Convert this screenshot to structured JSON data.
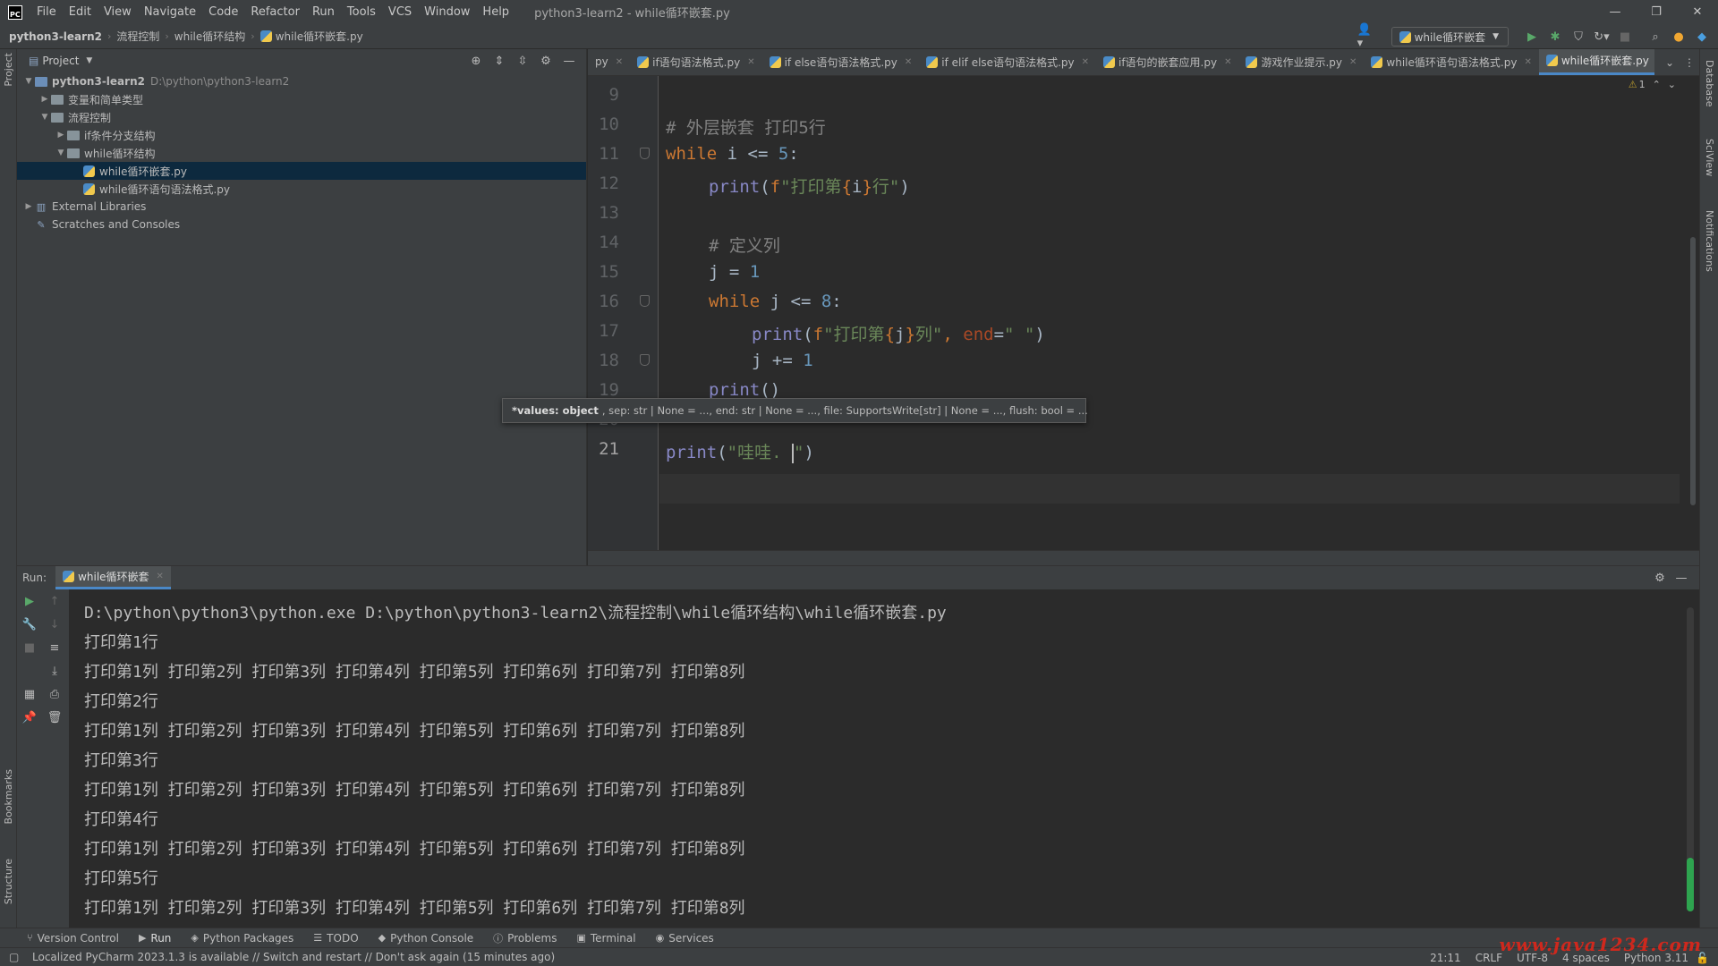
{
  "window": {
    "logo": "PC",
    "title": "python3-learn2 - while循环嵌套.py",
    "controls": [
      "—",
      "❐",
      "✕"
    ]
  },
  "menu": [
    "File",
    "Edit",
    "View",
    "Navigate",
    "Code",
    "Refactor",
    "Run",
    "Tools",
    "VCS",
    "Window",
    "Help"
  ],
  "breadcrumbs": [
    "python3-learn2",
    "流程控制",
    "while循环结构",
    "while循环嵌套.py"
  ],
  "run_config": "while循环嵌套",
  "project_panel": {
    "title": "Project",
    "tree": [
      {
        "label": "python3-learn2",
        "hint": "D:\\python\\python3-learn2",
        "indent": 0,
        "arrow": "▼",
        "icon": "folder",
        "bold": true
      },
      {
        "label": "变量和简单类型",
        "indent": 1,
        "arrow": "▶",
        "icon": "folder"
      },
      {
        "label": "流程控制",
        "indent": 1,
        "arrow": "▼",
        "icon": "folder"
      },
      {
        "label": "if条件分支结构",
        "indent": 2,
        "arrow": "▶",
        "icon": "folder"
      },
      {
        "label": "while循环结构",
        "indent": 2,
        "arrow": "▼",
        "icon": "folder"
      },
      {
        "label": "while循环嵌套.py",
        "indent": 3,
        "arrow": "",
        "icon": "py",
        "selected": true
      },
      {
        "label": "while循环语句语法格式.py",
        "indent": 3,
        "arrow": "",
        "icon": "py"
      },
      {
        "label": "External Libraries",
        "indent": 0,
        "arrow": "▶",
        "icon": "lib"
      },
      {
        "label": "Scratches and Consoles",
        "indent": 0,
        "arrow": "",
        "icon": "scratch"
      }
    ]
  },
  "editor": {
    "tabs": [
      {
        "label": "py",
        "partial": true
      },
      {
        "label": "if语句语法格式.py"
      },
      {
        "label": "if else语句语法格式.py"
      },
      {
        "label": "if elif else语句语法格式.py"
      },
      {
        "label": "if语句的嵌套应用.py"
      },
      {
        "label": "游戏作业提示.py"
      },
      {
        "label": "while循环语句语法格式.py"
      },
      {
        "label": "while循环嵌套.py",
        "active": true
      }
    ],
    "inspection": {
      "warnings": "1",
      "up": "⌃",
      "down": "⌄"
    },
    "line_numbers": [
      "9",
      "10",
      "11",
      "12",
      "13",
      "14",
      "15",
      "16",
      "17",
      "18",
      "19",
      "20",
      "21"
    ],
    "code_lines": {
      "l10": "# 外层嵌套 打印5行",
      "l11_kw": "while",
      "l11_rest": " i <= ",
      "l11_num": "5",
      "l11_end": ":",
      "l12_fn": "print",
      "l12_open": "(",
      "l12_f": "f",
      "l12_s1": "\"打印第",
      "l12_var": "i",
      "l12_s2": "行\"",
      "l12_close": ")",
      "l14": "# 定义列",
      "l15_a": "j = ",
      "l15_num": "1",
      "l16_kw": "while",
      "l16_rest": " j <= ",
      "l16_num": "8",
      "l16_end": ":",
      "l17_fn": "print",
      "l17_open": "(",
      "l17_f": "f",
      "l17_s1": "\"打印第",
      "l17_var": "j",
      "l17_s2": "列\"",
      "l17_comma": ", ",
      "l17_param": "end",
      "l17_eq": "=",
      "l17_s3": "\" \"",
      "l17_close": ")",
      "l18_a": "j += ",
      "l18_num": "1",
      "l19_fn": "print",
      "l19_paren": "()",
      "l21_fn": "print",
      "l21_open": "(",
      "l21_s1": "\"哇哇. ",
      "l21_s2": "\"",
      "l21_close": ")"
    },
    "tooltip": {
      "bold": "*values: object",
      "rest": ", sep: str | None = ..., end: str | None = ..., file: SupportsWrite[str] | None = ..., flush: bool = ..."
    }
  },
  "run_panel": {
    "label": "Run:",
    "tab": "while循环嵌套",
    "console": [
      "D:\\python\\python3\\python.exe D:\\python\\python3-learn2\\流程控制\\while循环结构\\while循环嵌套.py",
      "打印第1行",
      "打印第1列 打印第2列 打印第3列 打印第4列 打印第5列 打印第6列 打印第7列 打印第8列",
      "打印第2行",
      "打印第1列 打印第2列 打印第3列 打印第4列 打印第5列 打印第6列 打印第7列 打印第8列",
      "打印第3行",
      "打印第1列 打印第2列 打印第3列 打印第4列 打印第5列 打印第6列 打印第7列 打印第8列",
      "打印第4行",
      "打印第1列 打印第2列 打印第3列 打印第4列 打印第5列 打印第6列 打印第7列 打印第8列",
      "打印第5行",
      "打印第1列 打印第2列 打印第3列 打印第4列 打印第5列 打印第6列 打印第7列 打印第8列"
    ]
  },
  "left_stripe": {
    "project": "Project",
    "bookmarks": "Bookmarks",
    "structure": "Structure"
  },
  "right_stripe": {
    "database": "Database",
    "sciview": "SciView",
    "notifications": "Notifications"
  },
  "tool_windows": [
    {
      "label": "Version Control",
      "icon": "⑂"
    },
    {
      "label": "Run",
      "icon": "▶",
      "active": true
    },
    {
      "label": "Python Packages",
      "icon": "◈"
    },
    {
      "label": "TODO",
      "icon": "☰"
    },
    {
      "label": "Python Console",
      "icon": "◆"
    },
    {
      "label": "Problems",
      "icon": "ⓘ"
    },
    {
      "label": "Terminal",
      "icon": "▣"
    },
    {
      "label": "Services",
      "icon": "◉"
    }
  ],
  "status": {
    "message": "Localized PyCharm 2023.1.3 is available // Switch and restart // Don't ask again (15 minutes ago)",
    "position": "21:11",
    "line_sep": "CRLF",
    "encoding": "UTF-8",
    "indent": "4 spaces",
    "interpreter": "Python 3.11"
  },
  "watermark": "www.java1234.com"
}
